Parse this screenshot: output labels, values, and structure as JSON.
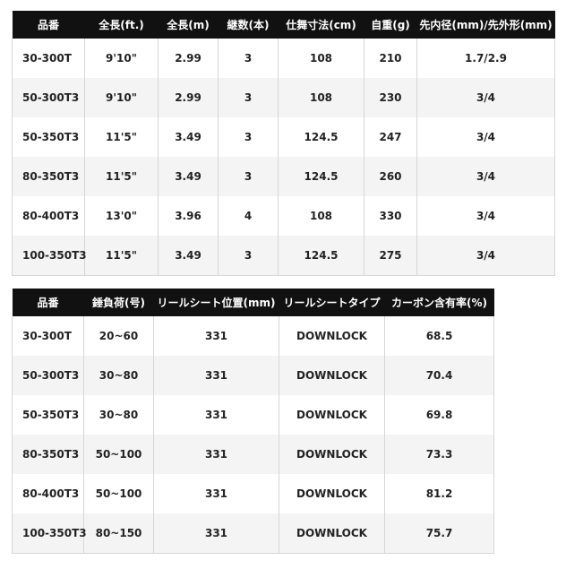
{
  "table1": {
    "headers": [
      "品番",
      "全長(ft.)",
      "全長(m)",
      "継数(本)",
      "仕舞寸法(cm)",
      "自重(g)",
      "先内径(mm)/先外形(mm)"
    ],
    "rows": [
      [
        "30-300T",
        "9'10\"",
        "2.99",
        "3",
        "108",
        "210",
        "1.7/2.9"
      ],
      [
        "50-300T3",
        "9'10\"",
        "2.99",
        "3",
        "108",
        "230",
        "3/4"
      ],
      [
        "50-350T3",
        "11'5\"",
        "3.49",
        "3",
        "124.5",
        "247",
        "3/4"
      ],
      [
        "80-350T3",
        "11'5\"",
        "3.49",
        "3",
        "124.5",
        "260",
        "3/4"
      ],
      [
        "80-400T3",
        "13'0\"",
        "3.96",
        "4",
        "108",
        "330",
        "3/4"
      ],
      [
        "100-350T3",
        "11'5\"",
        "3.49",
        "3",
        "124.5",
        "275",
        "3/4"
      ]
    ]
  },
  "table2": {
    "headers": [
      "品番",
      "錘負荷(号)",
      "リールシート位置(mm)",
      "リールシートタイプ",
      "カーボン含有率(%)"
    ],
    "rows": [
      [
        "30-300T",
        "20~60",
        "331",
        "DOWNLOCK",
        "68.5"
      ],
      [
        "50-300T3",
        "30~80",
        "331",
        "DOWNLOCK",
        "70.4"
      ],
      [
        "50-350T3",
        "30~80",
        "331",
        "DOWNLOCK",
        "69.8"
      ],
      [
        "80-350T3",
        "50~100",
        "331",
        "DOWNLOCK",
        "73.3"
      ],
      [
        "80-400T3",
        "50~100",
        "331",
        "DOWNLOCK",
        "81.2"
      ],
      [
        "100-350T3",
        "80~150",
        "331",
        "DOWNLOCK",
        "75.7"
      ]
    ]
  }
}
